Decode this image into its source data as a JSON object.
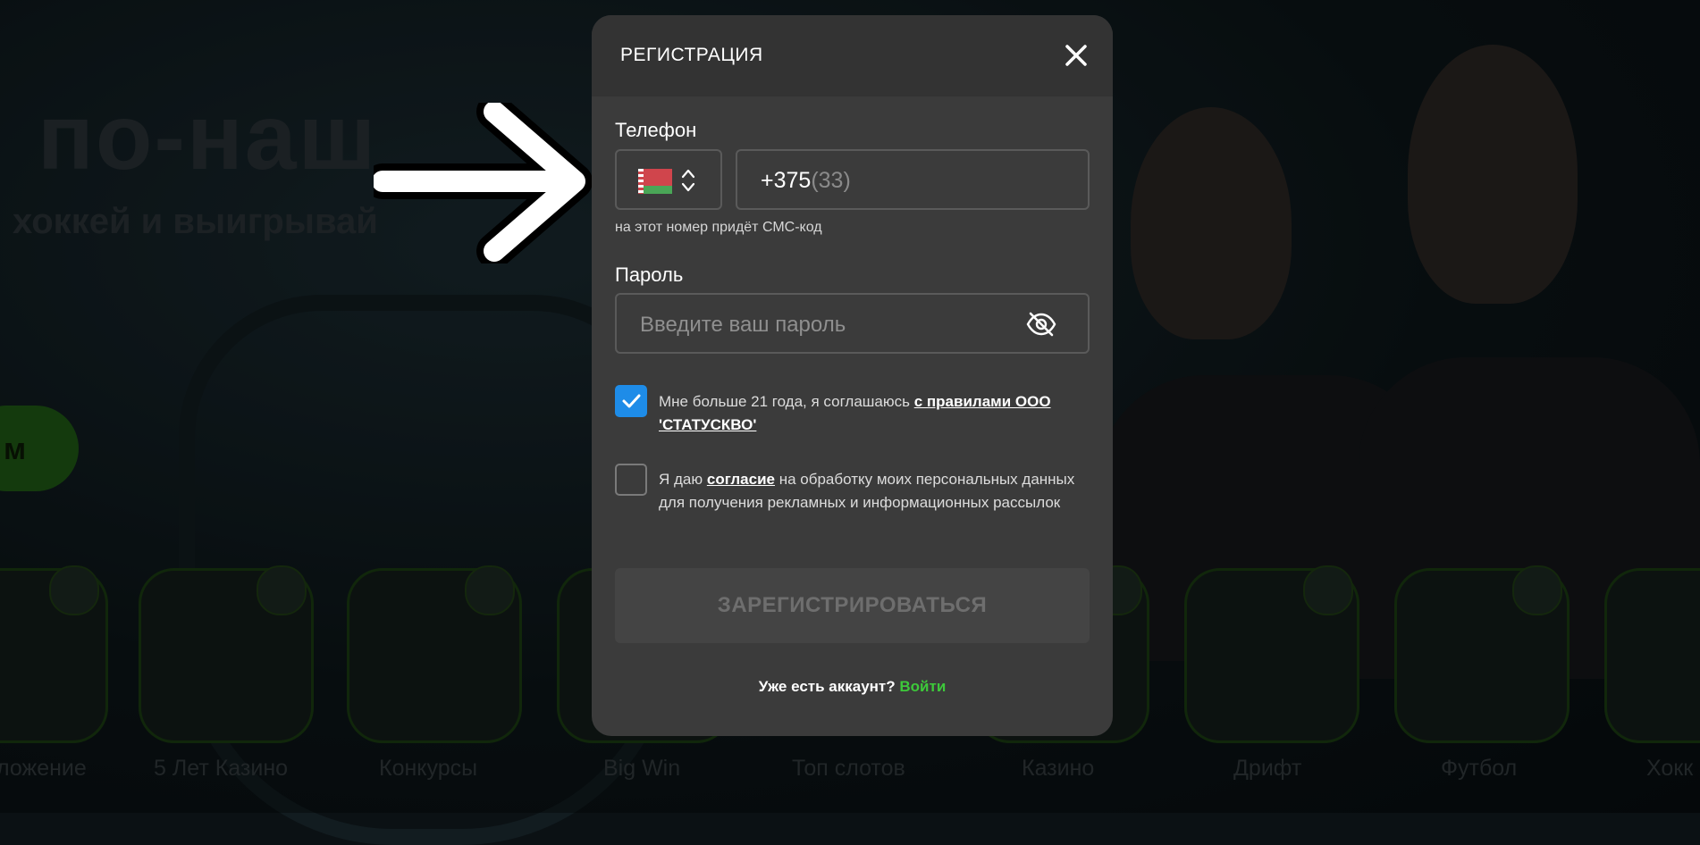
{
  "background": {
    "title": "по-наш",
    "subtitle": "хоккей и выигрывай",
    "green_button_fragment": "м",
    "categories": [
      "ложение",
      "5 Лет Казино",
      "Конкурсы",
      "Big Win",
      "Топ слотов",
      "Казино",
      "Дрифт",
      "Футбол",
      "Хокк"
    ]
  },
  "modal": {
    "title": "РЕГИСТРАЦИЯ",
    "phone": {
      "label": "Телефон",
      "country_icon": "belarus-flag-icon",
      "prefix": "+375",
      "mask": "(33)",
      "hint": "на этот номер придёт СМС-код"
    },
    "password": {
      "label": "Пароль",
      "placeholder": "Введите ваш пароль",
      "toggle_icon": "eye-off-icon"
    },
    "agreement_rules": {
      "checked": true,
      "text": "Мне больше 21 года, я соглашаюсь ",
      "link": "с правилами ООО 'СТАТУСКВО'"
    },
    "agreement_marketing": {
      "checked": false,
      "text_before": "Я даю ",
      "link": "согласие",
      "text_after": " на обработку моих персональных данных для получения рекламных и информационных рассылок"
    },
    "submit_label": "ЗАРЕГИСТРИРОВАТЬСЯ",
    "login_prompt": "Уже есть аккаунт?",
    "login_link": "Войти"
  },
  "colors": {
    "modal_bg": "#3b3b3b",
    "header_bg": "#333333",
    "checkbox_accent": "#1e8ce8",
    "login_link": "#3dc93a"
  }
}
